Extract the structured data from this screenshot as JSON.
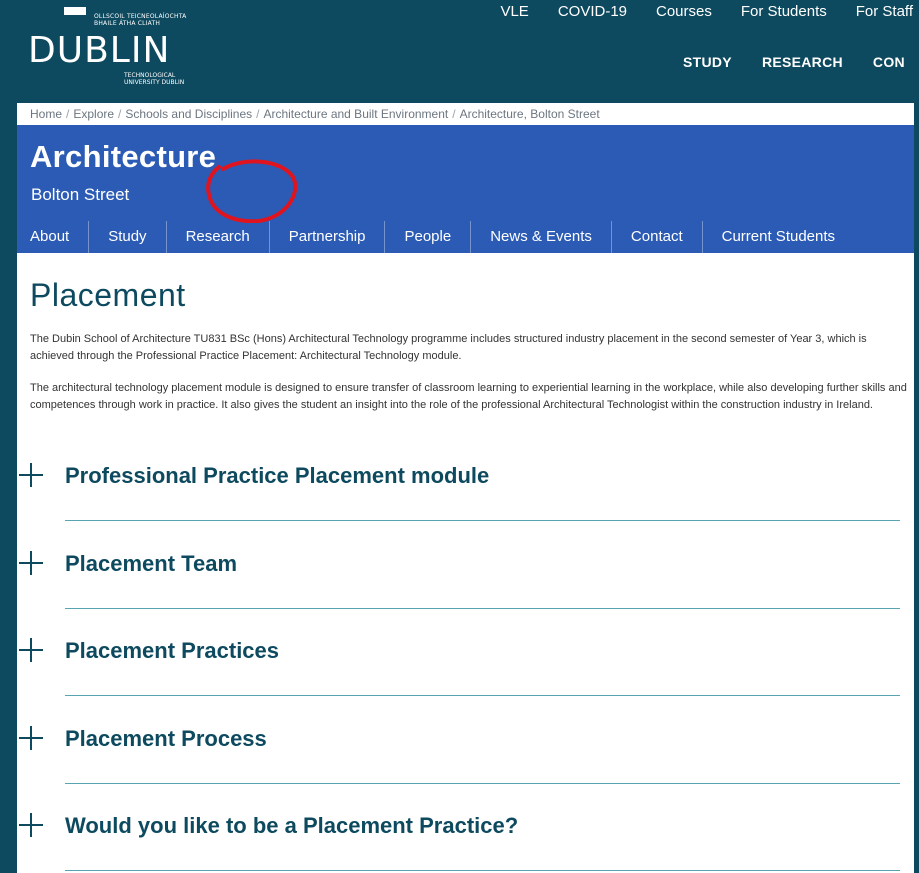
{
  "logo": {
    "top_text": "OLLSCOIL TEICNEOLAÍOCHTA\nBHAILE ÁTHA CLIATH",
    "word": "DUBLIN",
    "bottom_text": "TECHNOLOGICAL\nUNIVERSITY DUBLIN"
  },
  "utility_nav": [
    "VLE",
    "COVID-19",
    "Courses",
    "For Students",
    "For Staff"
  ],
  "main_nav": [
    "STUDY",
    "RESEARCH",
    "CON"
  ],
  "breadcrumb": [
    "Home",
    "Explore",
    "Schools and Disciplines",
    "Architecture and Built Environment",
    "Architecture, Bolton Street"
  ],
  "banner": {
    "title": "Architecture",
    "subtitle": "Bolton Street"
  },
  "section_nav": [
    "About",
    "Study",
    "Research",
    "Partnership",
    "People",
    "News & Events",
    "Contact",
    "Current Students"
  ],
  "page": {
    "heading": "Placement",
    "paragraph1": "The Dubin School of Architecture TU831 BSc (Hons) Architectural Technology programme includes structured industry placement in the second semester of Year 3, which is achieved through the Professional Practice Placement: Architectural Technology module.",
    "paragraph2": "The architectural technology placement module is designed to ensure transfer of classroom learning to experiential learning in the workplace, while also developing further skills and competences through work in practice. It also gives the student an insight into the role of the professional Architectural Technologist within the construction industry in Ireland."
  },
  "accordion": [
    "Professional Practice Placement module",
    "Placement Team",
    "Placement Practices",
    "Placement Process",
    "Would you like to be a Placement Practice?"
  ],
  "colors": {
    "background": "#0e4a5f",
    "banner": "#2b5bb4",
    "heading": "#0e4a5f",
    "annotation": "#e0141e"
  }
}
